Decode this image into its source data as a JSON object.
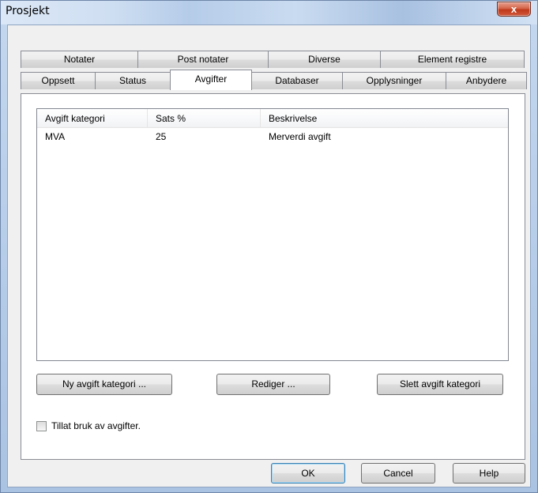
{
  "window": {
    "title": "Prosjekt",
    "close_label": "x"
  },
  "tabs_row1": [
    {
      "label": "Notater"
    },
    {
      "label": "Post notater"
    },
    {
      "label": "Diverse"
    },
    {
      "label": "Element registre"
    }
  ],
  "tabs_row2": [
    {
      "label": "Oppsett"
    },
    {
      "label": "Status"
    },
    {
      "label": "Avgifter",
      "selected": true
    },
    {
      "label": "Databaser"
    },
    {
      "label": "Opplysninger"
    },
    {
      "label": "Anbydere"
    }
  ],
  "list": {
    "columns": [
      "Avgift kategori",
      "Sats %",
      "Beskrivelse"
    ],
    "rows": [
      [
        "MVA",
        "25",
        "Merverdi avgift"
      ]
    ]
  },
  "buttons": {
    "new_category": "Ny avgift kategori ...",
    "edit": "Rediger ...",
    "delete_category": "Slett avgift kategori"
  },
  "checkbox": {
    "label": "Tillat bruk av avgifter.",
    "checked": false
  },
  "dialog_buttons": {
    "ok": "OK",
    "cancel": "Cancel",
    "help": "Help"
  }
}
